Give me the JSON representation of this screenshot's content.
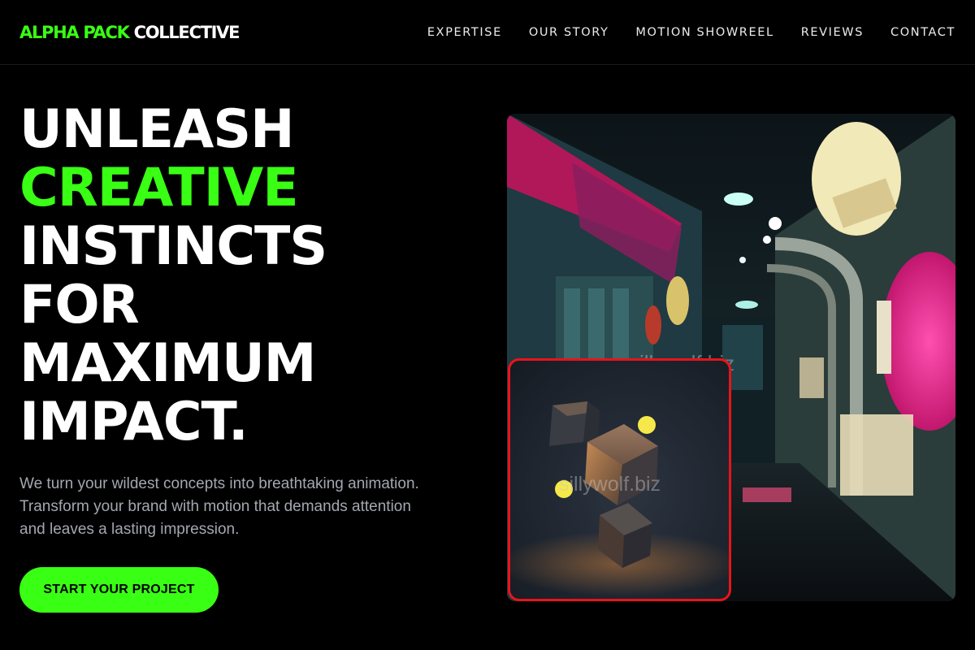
{
  "header": {
    "logo_accent": "ALPHA PACK",
    "logo_rest": "COLLECTIVE",
    "nav": [
      "EXPERTISE",
      "OUR STORY",
      "MOTION SHOWREEL",
      "REVIEWS",
      "CONTACT"
    ]
  },
  "hero": {
    "lines": [
      "UNLEASH",
      "CREATIVE",
      "INSTINCTS",
      "FOR",
      "MAXIMUM",
      "IMPACT."
    ],
    "subtitle": "We turn your wildest concepts into breathtaking animation. Transform your brand with motion that demands attention and leaves a lasting impression.",
    "cta_label": "START YOUR PROJECT"
  },
  "media": {
    "main_watermark": "sillywolf.biz",
    "inset_watermark": "sillywolf.biz"
  },
  "colors": {
    "accent": "#39ff14",
    "background": "#000000",
    "inset_border": "#e8141a"
  }
}
